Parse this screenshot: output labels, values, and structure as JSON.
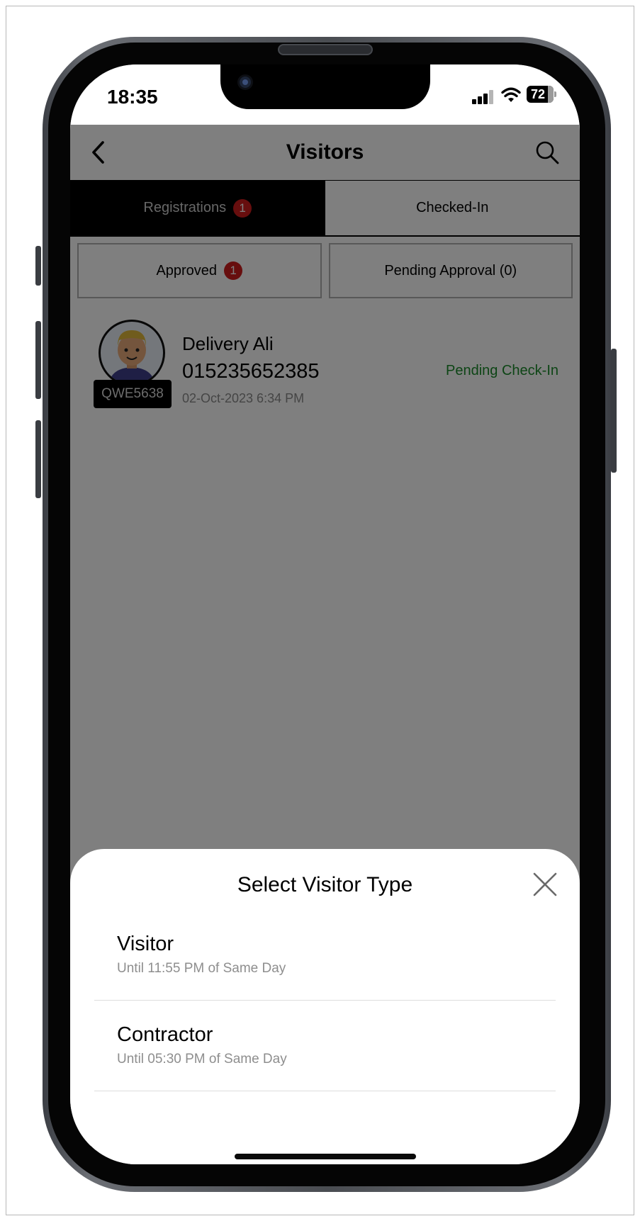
{
  "status_bar": {
    "time": "18:35",
    "battery": "72"
  },
  "nav": {
    "title": "Visitors"
  },
  "tabs": [
    {
      "label": "Registrations",
      "badge": "1"
    },
    {
      "label": "Checked-In"
    }
  ],
  "subtabs": [
    {
      "label": "Approved",
      "badge": "1"
    },
    {
      "label": "Pending Approval (0)"
    }
  ],
  "visitor": {
    "name": "Delivery Ali",
    "phone": "015235652385",
    "date": "02-Oct-2023 6:34 PM",
    "plate": "QWE5638",
    "status": "Pending Check-In"
  },
  "sheet": {
    "title": "Select Visitor Type",
    "options": [
      {
        "title": "Visitor",
        "subtitle": "Until 11:55 PM of Same Day"
      },
      {
        "title": "Contractor",
        "subtitle": "Until 05:30 PM of Same Day"
      }
    ]
  },
  "colors": {
    "badge": "#cf1c1c",
    "status_green": "#1a8a2a",
    "active_tab": "#000000"
  }
}
